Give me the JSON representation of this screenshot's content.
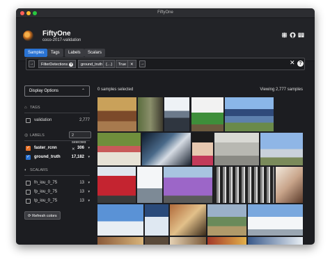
{
  "window": {
    "title": "FiftyOne",
    "traffic_colors": {
      "close": "#fe5f57",
      "minimize": "#febc2e",
      "maximize": "#28c840"
    }
  },
  "header": {
    "app_name": "FiftyOne",
    "dataset": "coco-2017-validation",
    "icons": [
      "slack-icon",
      "github-icon",
      "docs-icon"
    ]
  },
  "tabs": [
    {
      "label": "Samples",
      "active": true
    },
    {
      "label": "Tags",
      "active": false
    },
    {
      "label": "Labels",
      "active": false
    },
    {
      "label": "Scalars",
      "active": false
    }
  ],
  "filterbar": {
    "left_arrow": "→",
    "right_arrow": "→",
    "stage": "FilterDetections",
    "field": "ground_truth",
    "expr": "{…}",
    "bool": "True",
    "remove": "✕",
    "clear": "✕",
    "help": "?"
  },
  "sidebar": {
    "display_options": "Display Options",
    "tags": {
      "title": "TAGS",
      "items": [
        {
          "label": "validation",
          "count": "2,777"
        }
      ]
    },
    "labels": {
      "title": "LABELS",
      "selected": "2 selected ✕",
      "items": [
        {
          "label": "faster_rcnn",
          "count": "306",
          "color": "#e8732a"
        },
        {
          "label": "ground_truth",
          "count": "17,182",
          "color": "#2a73d3"
        }
      ]
    },
    "scalars": {
      "title": "SCALARS",
      "items": [
        {
          "label": "fn_iou_0_75",
          "count": "13"
        },
        {
          "label": "fp_iou_0_75",
          "count": "13"
        },
        {
          "label": "tp_iou_0_75",
          "count": "13"
        }
      ]
    },
    "refresh": "Refresh colors"
  },
  "grid": {
    "selected_text": "0 samples selected",
    "viewing_text": "Viewing 2,777 samples"
  },
  "colors": {
    "accent": "#2a73d3",
    "background": "#1c1d21"
  }
}
